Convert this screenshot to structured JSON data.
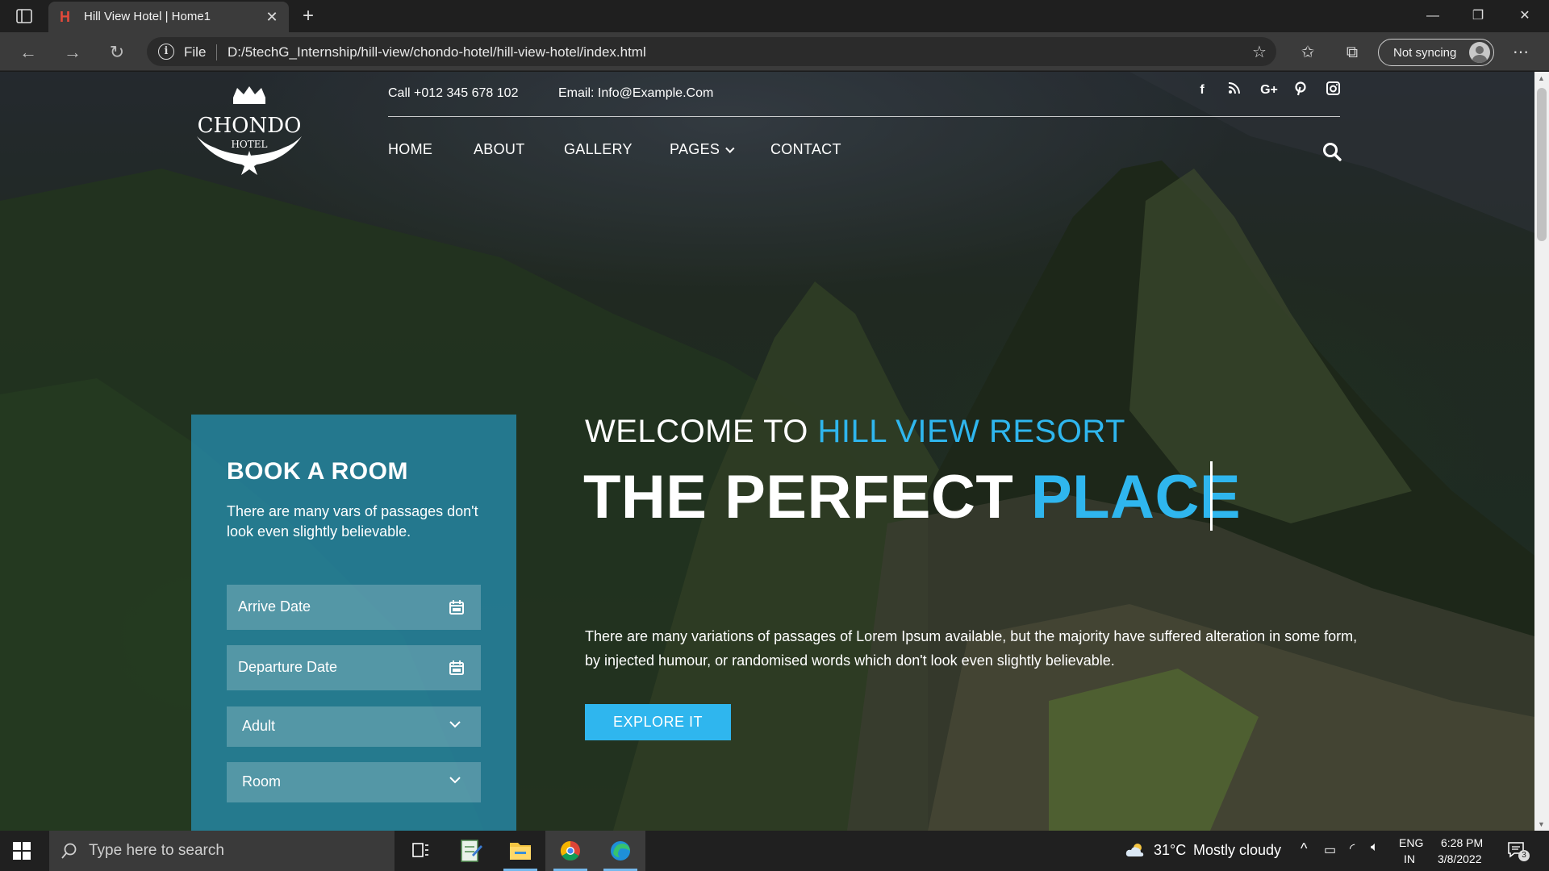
{
  "browser": {
    "tab_title": "Hill View Hotel | Home1",
    "url_scheme": "File",
    "url": "D:/5techG_Internship/hill-view/chondo-hotel/hill-view-hotel/index.html",
    "sync_label": "Not syncing"
  },
  "site": {
    "logo": {
      "line1": "CHONDO",
      "line2": "HOTEL"
    },
    "phone": "Call +012 345 678 102",
    "email": "Email: Info@Example.Com",
    "social": [
      "facebook-icon",
      "rss-icon",
      "google-plus-icon",
      "pinterest-icon",
      "instagram-icon"
    ],
    "nav": [
      "HOME",
      "ABOUT",
      "GALLERY",
      "PAGES",
      "CONTACT"
    ],
    "accent_color": "#2fb6ee"
  },
  "booking": {
    "title": "BOOK A ROOM",
    "subtitle": "There are many vars of passages don't look even slightly believable.",
    "arrive_placeholder": "Arrive Date",
    "departure_placeholder": "Departure Date",
    "adult_value": "Adult",
    "room_value": "Room"
  },
  "hero": {
    "welcome_prefix": "WELCOME TO",
    "welcome_highlight": "HILL VIEW RESORT",
    "headline_prefix": "THE PERFECT",
    "headline_highlight": "PLACE",
    "description": "There are many variations of passages of Lorem Ipsum available, but the majority have suffered alteration in some form, by injected humour, or randomised words which don't look even slightly believable.",
    "cta": "EXPLORE IT"
  },
  "taskbar": {
    "search_placeholder": "Type here to search",
    "weather_temp": "31°C",
    "weather_text": "Mostly cloudy",
    "lang1": "ENG",
    "lang2": "IN",
    "time": "6:28 PM",
    "date": "3/8/2022",
    "notifications": "3"
  }
}
